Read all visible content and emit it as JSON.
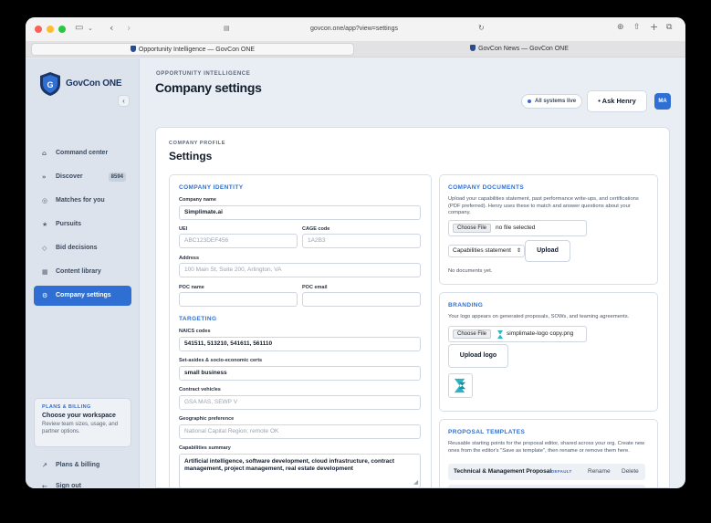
{
  "browser": {
    "url": "govcon.one/app?view=settings",
    "tabs": [
      {
        "label": "Opportunity Intelligence — GovCon ONE"
      },
      {
        "label": "GovCon News — GovCon ONE"
      }
    ]
  },
  "sidebar": {
    "brand": "GovCon ONE",
    "items": [
      {
        "label": "Command center",
        "icon": "home-icon"
      },
      {
        "label": "Discover",
        "icon": "compass-icon",
        "badge": "8594"
      },
      {
        "label": "Matches for you",
        "icon": "target-icon"
      },
      {
        "label": "Pursuits",
        "icon": "star-icon"
      },
      {
        "label": "Bid decisions",
        "icon": "diamond-icon"
      },
      {
        "label": "Content library",
        "icon": "library-icon"
      },
      {
        "label": "Company settings",
        "icon": "gear-icon"
      }
    ],
    "plan": {
      "eyebrow": "PLANS & BILLING",
      "title": "Choose your workspace",
      "desc": "Review team sizes, usage, and partner options."
    },
    "footer": [
      {
        "label": "Plans & billing",
        "icon": "arrow-up-right-icon"
      },
      {
        "label": "Sign out",
        "icon": "arrow-left-icon"
      }
    ]
  },
  "header": {
    "eyebrow": "OPPORTUNITY INTELLIGENCE",
    "title": "Company settings",
    "status": "All systems live",
    "ask_button": "• Ask Henry",
    "avatar": "MA"
  },
  "profile": {
    "eyebrow": "COMPANY PROFILE",
    "title": "Settings"
  },
  "identity": {
    "title": "COMPANY IDENTITY",
    "company_name_label": "Company name",
    "company_name": "Simplimate.ai",
    "uei_label": "UEI",
    "uei_placeholder": "ABC123DEF456",
    "cage_label": "CAGE code",
    "cage_placeholder": "1A2B3",
    "address_label": "Address",
    "address_placeholder": "100 Main St, Suite 200, Arlington, VA",
    "poc_name_label": "POC name",
    "poc_name": "",
    "poc_email_label": "POC email",
    "poc_email": ""
  },
  "targeting": {
    "title": "TARGETING",
    "naics_label": "NAICS codes",
    "naics": "541511, 513210, 541611, 561110",
    "setasides_label": "Set-asides & socio-economic certs",
    "setasides": "small business",
    "vehicles_label": "Contract vehicles",
    "vehicles_placeholder": "GSA MAS, SEWP V",
    "geo_label": "Geographic preference",
    "geo_placeholder": "National Capital Region; remote OK",
    "capabilities_label": "Capabilities summary",
    "capabilities": "Artificial intelligence, software development, cloud infrastructure, contract management, project management, real estate development"
  },
  "documents": {
    "title": "COMPANY DOCUMENTS",
    "desc": "Upload your capabilities statement, past performance write-ups, and certifications (PDF preferred). Henry uses these to match and answer questions about your company.",
    "choose_label": "Choose File",
    "file_status": "no file selected",
    "type_selected": "Capabilities statement",
    "upload_label": "Upload",
    "empty": "No documents yet."
  },
  "branding": {
    "title": "BRANDING",
    "desc": "Your logo appears on generated proposals, SOWs, and teaming agreements.",
    "choose_label": "Choose File",
    "file_name": "simplimate-logo copy.png",
    "upload_label": "Upload logo"
  },
  "templates": {
    "title": "PROPOSAL TEMPLATES",
    "desc": "Reusable starting points for the proposal editor, shared across your org. Create new ones from the editor's \"Save as template\", then rename or remove them here.",
    "items": [
      {
        "name": "Technical & Management Proposal",
        "tag": "DEFAULT",
        "rename": "Rename",
        "delete": "Delete"
      }
    ]
  }
}
